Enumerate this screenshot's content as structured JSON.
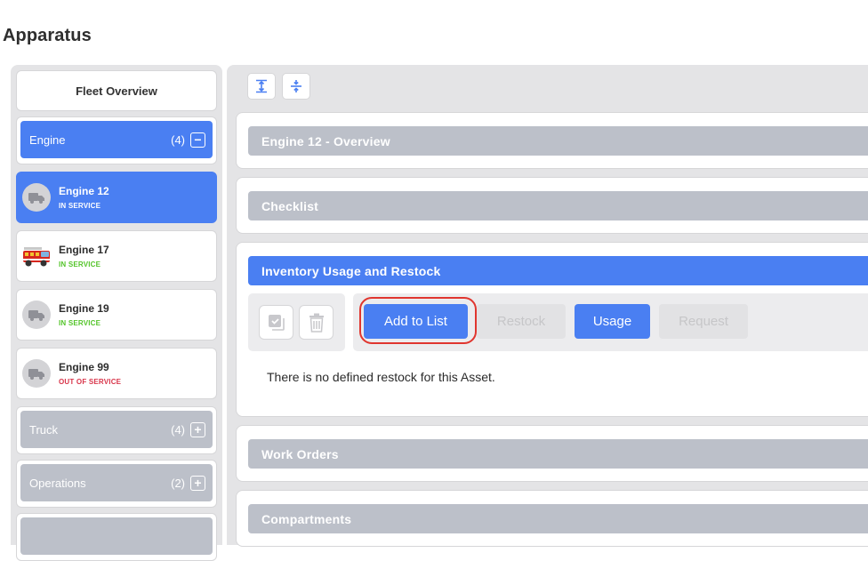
{
  "page": {
    "title": "Apparatus"
  },
  "sidebar": {
    "fleet_overview": "Fleet Overview",
    "groups": {
      "engine": {
        "label": "Engine",
        "count": "(4)",
        "toggle": "−"
      },
      "truck": {
        "label": "Truck",
        "count": "(4)",
        "toggle": "+"
      },
      "operations": {
        "label": "Operations",
        "count": "(2)",
        "toggle": "+"
      }
    },
    "units": [
      {
        "name": "Engine 12",
        "status": "IN SERVICE",
        "avatar": "truck-icon",
        "selected": true
      },
      {
        "name": "Engine 17",
        "status": "IN SERVICE",
        "avatar": "fire-engine-photo"
      },
      {
        "name": "Engine 19",
        "status": "IN SERVICE",
        "avatar": "truck-icon"
      },
      {
        "name": "Engine 99",
        "status": "OUT OF SERVICE",
        "avatar": "truck-icon"
      }
    ]
  },
  "toolbar": {
    "expand_all": "expand-all-icon",
    "collapse_all": "collapse-all-icon"
  },
  "sections": {
    "overview": "Engine 12 - Overview",
    "checklist": "Checklist",
    "inventory": {
      "title": "Inventory Usage and Restock",
      "buttons": {
        "add_to_list": "Add to List",
        "restock": "Restock",
        "usage": "Usage",
        "request": "Request"
      },
      "empty_message": "There is no defined restock for this Asset."
    },
    "work_orders": "Work Orders",
    "compartments": "Compartments"
  },
  "colors": {
    "primary": "#4a7ff2",
    "section_grey": "#bcc0c9",
    "status_in_service": "#54c42a",
    "status_out_of_service": "#d8354a",
    "highlight": "#e0362f"
  }
}
